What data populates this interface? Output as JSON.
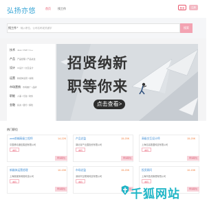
{
  "header": {
    "logo": "弘扬亦悠",
    "nav": [
      "首页",
      "找工作"
    ],
    "login": "登录",
    "register": "注册"
  },
  "search": {
    "type": "找工作",
    "placeholder": "输入职位、公司名称或关键字",
    "button": "搜索"
  },
  "categories": [
    {
      "title": "技术",
      "sub": "Java / PHP / C++"
    },
    {
      "title": "产品",
      "sub": "产品经理 / 产品总监"
    },
    {
      "title": "设计",
      "sub": "UI设计 / 交互设计"
    },
    {
      "title": "运营",
      "sub": "新媒体运营 / 编辑"
    },
    {
      "title": "市场营销",
      "sub": "市场推广 / 品牌"
    },
    {
      "title": "职能",
      "sub": "人事 / 行政 / 财务"
    },
    {
      "title": "金融",
      "sub": "投资 / 银行 / 保险"
    }
  ],
  "banner": {
    "line1": "招贤纳新",
    "line2": "职等你来",
    "button": "点击查看>"
  },
  "section": {
    "title": "热门职位"
  },
  "jobs": [
    {
      "title": "web前端高级工程师",
      "salary": "14-22K",
      "company": "中国移动通信集团有限公司",
      "tag": "本科",
      "apply": "申请职位"
    },
    {
      "title": "产品总监",
      "salary": "15-20K",
      "company": "湖北省产业园投资有限公司",
      "tag": "本科",
      "apply": "申请职位"
    },
    {
      "title": "高级交互设计师",
      "salary": "15-20K",
      "company": "上海信息数据科技有限公司",
      "tag": "本科",
      "apply": "申请职位"
    },
    {
      "title": "新媒体运营经理",
      "salary": "10-15K",
      "company": "上海新媒体网络科技公司",
      "tag": "本科",
      "apply": "申请职位"
    },
    {
      "title": "市场总监",
      "salary": "15-20K",
      "company": "深圳市互联网科技有限公司",
      "tag": "本科",
      "apply": "申请职位"
    },
    {
      "title": "投资顾问",
      "salary": "10-15K",
      "company": "上海市投资管理有限公司",
      "tag": "本科",
      "apply": "申请职位"
    }
  ],
  "watermark": "千狐网站",
  "colors": {
    "accent": "#e8546a",
    "logo": "#3aa6d6",
    "salary": "#f07c3a",
    "link": "#3a8ad3"
  }
}
